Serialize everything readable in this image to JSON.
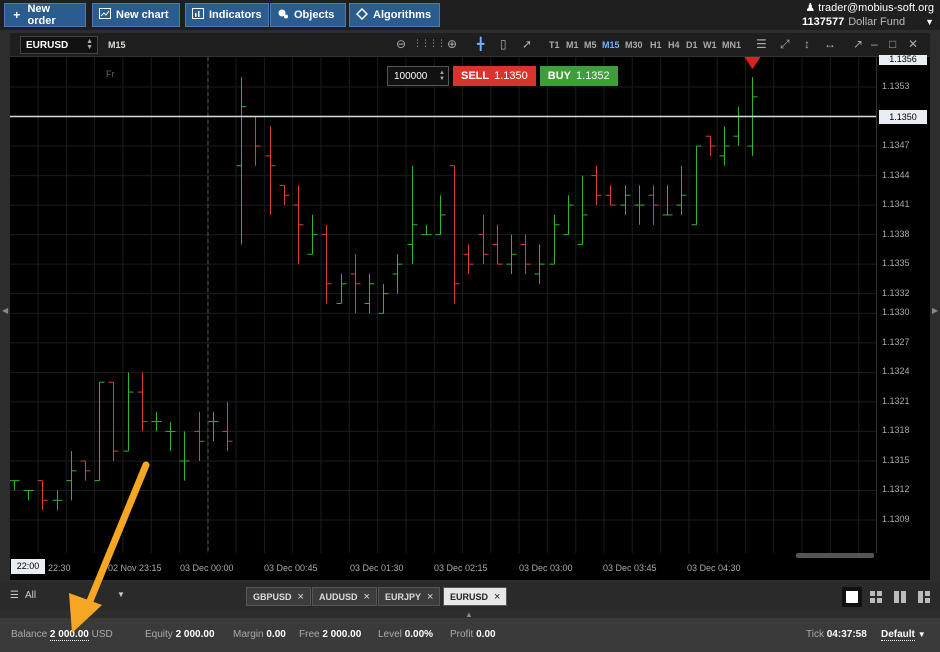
{
  "toolbar": {
    "new_order": "New order",
    "new_chart": "New chart",
    "indicators": "Indicators",
    "objects": "Objects",
    "algorithms": "Algorithms"
  },
  "account": {
    "email": "trader@mobius-soft.org",
    "number": "1137577",
    "fund": "Dollar Fund"
  },
  "chart": {
    "symbol": "EURUSD",
    "timeframe": "M15",
    "timeframes": [
      "T1",
      "M1",
      "M5",
      "M15",
      "M30",
      "H1",
      "H4",
      "D1",
      "W1",
      "MN1"
    ],
    "active_timeframe": "M15",
    "weekday_marker": "Fr",
    "current_price": "1.1350",
    "top_price_stub": "1.1356",
    "cursor_time": "22:00",
    "bull_color": "#2db52d",
    "bear_color": "#e03c3c"
  },
  "trade": {
    "quantity": "100000",
    "sell_label": "SELL",
    "sell_price": "1.1350",
    "buy_label": "BUY",
    "buy_price": "1.1352"
  },
  "price_axis": [
    "1.1353",
    "1.1350",
    "1.1347",
    "1.1344",
    "1.1341",
    "1.1338",
    "1.1335",
    "1.1332",
    "1.1330",
    "1.1327",
    "1.1324",
    "1.1321",
    "1.1318",
    "1.1315",
    "1.1312",
    "1.1309"
  ],
  "time_axis": [
    "22:30",
    "02 Nov 23:15",
    "03 Dec 00:00",
    "03 Dec 00:45",
    "03 Dec 01:30",
    "03 Dec 02:15",
    "03 Dec 03:00",
    "03 Dec 03:45",
    "03 Dec 04:30"
  ],
  "chart_data": {
    "type": "ohlc",
    "bars": [
      {
        "o": 1.1313,
        "h": 1.1313,
        "l": 1.1312,
        "c": 1.1313
      },
      {
        "o": 1.1312,
        "h": 1.1312,
        "l": 1.1311,
        "c": 1.1312
      },
      {
        "o": 1.1313,
        "h": 1.1313,
        "l": 1.131,
        "c": 1.1311
      },
      {
        "o": 1.1311,
        "h": 1.1312,
        "l": 1.131,
        "c": 1.1311
      },
      {
        "o": 1.1313,
        "h": 1.1316,
        "l": 1.1311,
        "c": 1.1314
      },
      {
        "o": 1.1315,
        "h": 1.1315,
        "l": 1.1313,
        "c": 1.1314
      },
      {
        "o": 1.1313,
        "h": 1.1323,
        "l": 1.1313,
        "c": 1.1323
      },
      {
        "o": 1.1323,
        "h": 1.1323,
        "l": 1.1315,
        "c": 1.1316
      },
      {
        "o": 1.1316,
        "h": 1.1324,
        "l": 1.1316,
        "c": 1.1322
      },
      {
        "o": 1.1322,
        "h": 1.1324,
        "l": 1.1318,
        "c": 1.1319
      },
      {
        "o": 1.1319,
        "h": 1.132,
        "l": 1.1318,
        "c": 1.1319
      },
      {
        "o": 1.1318,
        "h": 1.1319,
        "l": 1.1316,
        "c": 1.1318
      },
      {
        "o": 1.1315,
        "h": 1.1318,
        "l": 1.1313,
        "c": 1.1315
      },
      {
        "o": 1.1318,
        "h": 1.132,
        "l": 1.1315,
        "c": 1.1317
      },
      {
        "o": 1.1319,
        "h": 1.132,
        "l": 1.1317,
        "c": 1.1319
      },
      {
        "o": 1.1318,
        "h": 1.1321,
        "l": 1.1316,
        "c": 1.1317
      },
      {
        "o": 1.1345,
        "h": 1.1354,
        "l": 1.1337,
        "c": 1.1351
      },
      {
        "o": 1.135,
        "h": 1.135,
        "l": 1.1345,
        "c": 1.1347
      },
      {
        "o": 1.1346,
        "h": 1.1349,
        "l": 1.134,
        "c": 1.1345
      },
      {
        "o": 1.1343,
        "h": 1.1343,
        "l": 1.1341,
        "c": 1.1342
      },
      {
        "o": 1.1341,
        "h": 1.1343,
        "l": 1.1335,
        "c": 1.1339
      },
      {
        "o": 1.1336,
        "h": 1.134,
        "l": 1.1336,
        "c": 1.1338
      },
      {
        "o": 1.1338,
        "h": 1.1339,
        "l": 1.1331,
        "c": 1.1333
      },
      {
        "o": 1.1331,
        "h": 1.1334,
        "l": 1.1331,
        "c": 1.1333
      },
      {
        "o": 1.1334,
        "h": 1.1336,
        "l": 1.133,
        "c": 1.1333
      },
      {
        "o": 1.1331,
        "h": 1.1334,
        "l": 1.133,
        "c": 1.1333
      },
      {
        "o": 1.133,
        "h": 1.1333,
        "l": 1.133,
        "c": 1.1332
      },
      {
        "o": 1.1334,
        "h": 1.1336,
        "l": 1.1332,
        "c": 1.1335
      },
      {
        "o": 1.1337,
        "h": 1.1345,
        "l": 1.1335,
        "c": 1.1339
      },
      {
        "o": 1.1338,
        "h": 1.1339,
        "l": 1.1338,
        "c": 1.1338
      },
      {
        "o": 1.1338,
        "h": 1.1342,
        "l": 1.1338,
        "c": 1.134
      },
      {
        "o": 1.1345,
        "h": 1.1345,
        "l": 1.1331,
        "c": 1.1333
      },
      {
        "o": 1.1336,
        "h": 1.1337,
        "l": 1.1334,
        "c": 1.1335
      },
      {
        "o": 1.1338,
        "h": 1.134,
        "l": 1.1335,
        "c": 1.1336
      },
      {
        "o": 1.1337,
        "h": 1.1339,
        "l": 1.1335,
        "c": 1.1335
      },
      {
        "o": 1.1335,
        "h": 1.1338,
        "l": 1.1334,
        "c": 1.1336
      },
      {
        "o": 1.1337,
        "h": 1.1338,
        "l": 1.1334,
        "c": 1.1335
      },
      {
        "o": 1.1334,
        "h": 1.1337,
        "l": 1.1333,
        "c": 1.1335
      },
      {
        "o": 1.1335,
        "h": 1.134,
        "l": 1.1335,
        "c": 1.1339
      },
      {
        "o": 1.1338,
        "h": 1.1342,
        "l": 1.1338,
        "c": 1.1341
      },
      {
        "o": 1.1337,
        "h": 1.1344,
        "l": 1.1337,
        "c": 1.134
      },
      {
        "o": 1.1344,
        "h": 1.1345,
        "l": 1.1341,
        "c": 1.1342
      },
      {
        "o": 1.1342,
        "h": 1.1343,
        "l": 1.1341,
        "c": 1.1341
      },
      {
        "o": 1.1341,
        "h": 1.1343,
        "l": 1.134,
        "c": 1.1342
      },
      {
        "o": 1.1341,
        "h": 1.1343,
        "l": 1.1339,
        "c": 1.1341
      },
      {
        "o": 1.1342,
        "h": 1.1343,
        "l": 1.1339,
        "c": 1.1341
      },
      {
        "o": 1.134,
        "h": 1.1343,
        "l": 1.134,
        "c": 1.134
      },
      {
        "o": 1.1341,
        "h": 1.1345,
        "l": 1.134,
        "c": 1.1342
      },
      {
        "o": 1.1339,
        "h": 1.1347,
        "l": 1.1339,
        "c": 1.1347
      },
      {
        "o": 1.1348,
        "h": 1.1348,
        "l": 1.1346,
        "c": 1.1347
      },
      {
        "o": 1.1346,
        "h": 1.1349,
        "l": 1.1345,
        "c": 1.1347
      },
      {
        "o": 1.1348,
        "h": 1.1351,
        "l": 1.1347,
        "c": 1.135
      },
      {
        "o": 1.1347,
        "h": 1.1354,
        "l": 1.1346,
        "c": 1.1352
      }
    ]
  },
  "symbol_tabs": [
    "GBPUSD",
    "AUDUSD",
    "EURJPY",
    "EURUSD"
  ],
  "active_tab": "EURUSD",
  "filter": {
    "label": "All"
  },
  "status": {
    "balance_label": "Balance",
    "balance_value": "2 000.00",
    "balance_currency": "USD",
    "equity_label": "Equity",
    "equity_value": "2 000.00",
    "margin_label": "Margin",
    "margin_value": "0.00",
    "free_label": "Free",
    "free_value": "2 000.00",
    "level_label": "Level",
    "level_value": "0.00%",
    "profit_label": "Profit",
    "profit_value": "0.00",
    "tick_label": "Tick",
    "tick_value": "04:37:58",
    "profile": "Default"
  }
}
